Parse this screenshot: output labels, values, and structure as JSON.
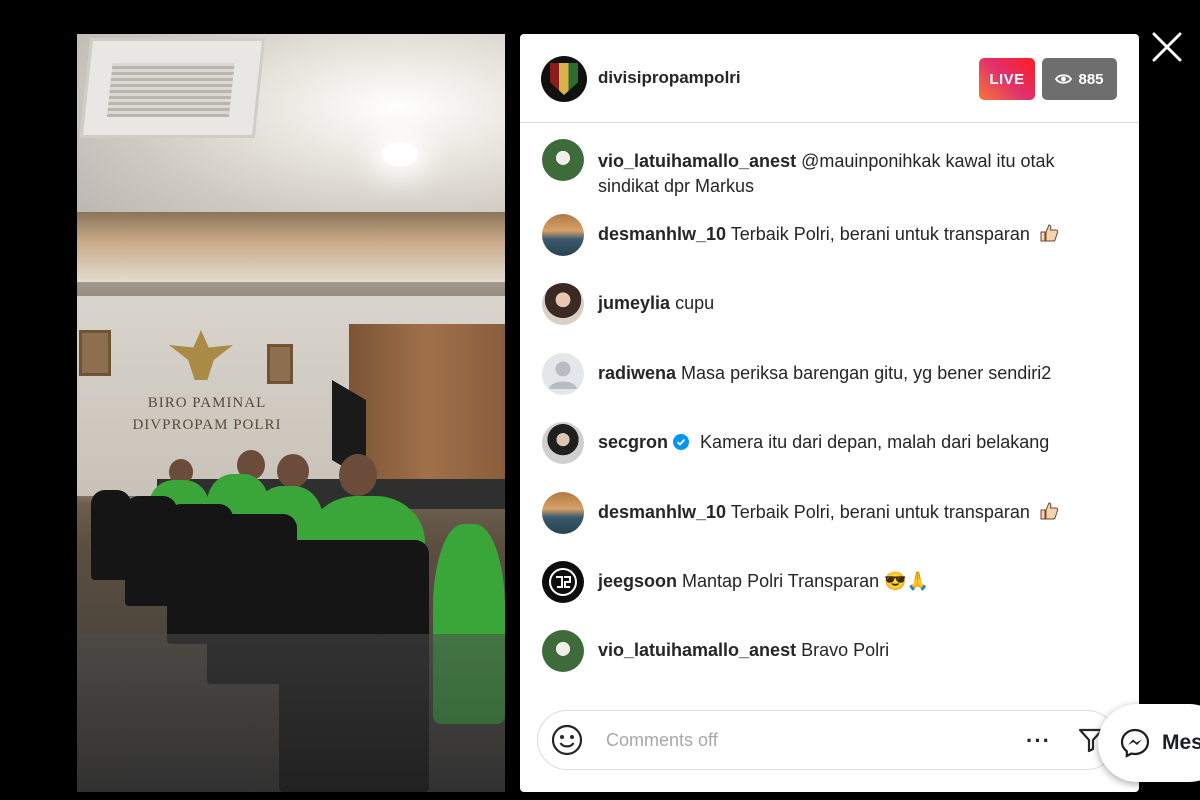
{
  "host": {
    "username": "divisipropampolri",
    "live_label": "LIVE",
    "viewer_count": "885"
  },
  "video": {
    "sign_line1": "BIRO PAMINAL",
    "sign_line2": "DIVPROPAM POLRI"
  },
  "comments": [
    {
      "username": "vio_latuihamallo_anest",
      "text": "@mauinponihkak kawal itu otak sindikat dpr Markus",
      "avatar": "vio-avatar"
    },
    {
      "username": "desmanhlw_10",
      "text": "Terbaik Polri, berani untuk transparan",
      "emoji": "thumbs-up",
      "avatar": "desman-avatar"
    },
    {
      "username": "jumeylia",
      "text": "cupu",
      "avatar": "jumeylia-avatar"
    },
    {
      "username": "radiwena",
      "text": "Masa periksa barengan gitu, yg bener sendiri2",
      "avatar": "default-avatar"
    },
    {
      "username": "secgron",
      "verified": true,
      "text": "Kamera itu dari depan, malah dari belakang",
      "avatar": "secgron-avatar"
    },
    {
      "username": "desmanhlw_10",
      "text": "Terbaik Polri, berani untuk transparan",
      "emoji": "thumbs-up",
      "avatar": "desman-avatar"
    },
    {
      "username": "jeegsoon",
      "text": "Mantap Polri Transparan 😎🙏",
      "avatar": "jeegsoon-avatar"
    },
    {
      "username": "vio_latuihamallo_anest",
      "text": "Bravo Polri",
      "avatar": "vio-avatar"
    }
  ],
  "footer": {
    "placeholder": "Comments off",
    "more_label": "···"
  },
  "messenger": {
    "label": "Mes"
  },
  "colors": {
    "live_gradient": [
      "#f77737",
      "#e1306c",
      "#fd1d1d"
    ],
    "viewer_badge": "#6e6e6e",
    "verified": "#0095f6",
    "background": "#000000"
  }
}
